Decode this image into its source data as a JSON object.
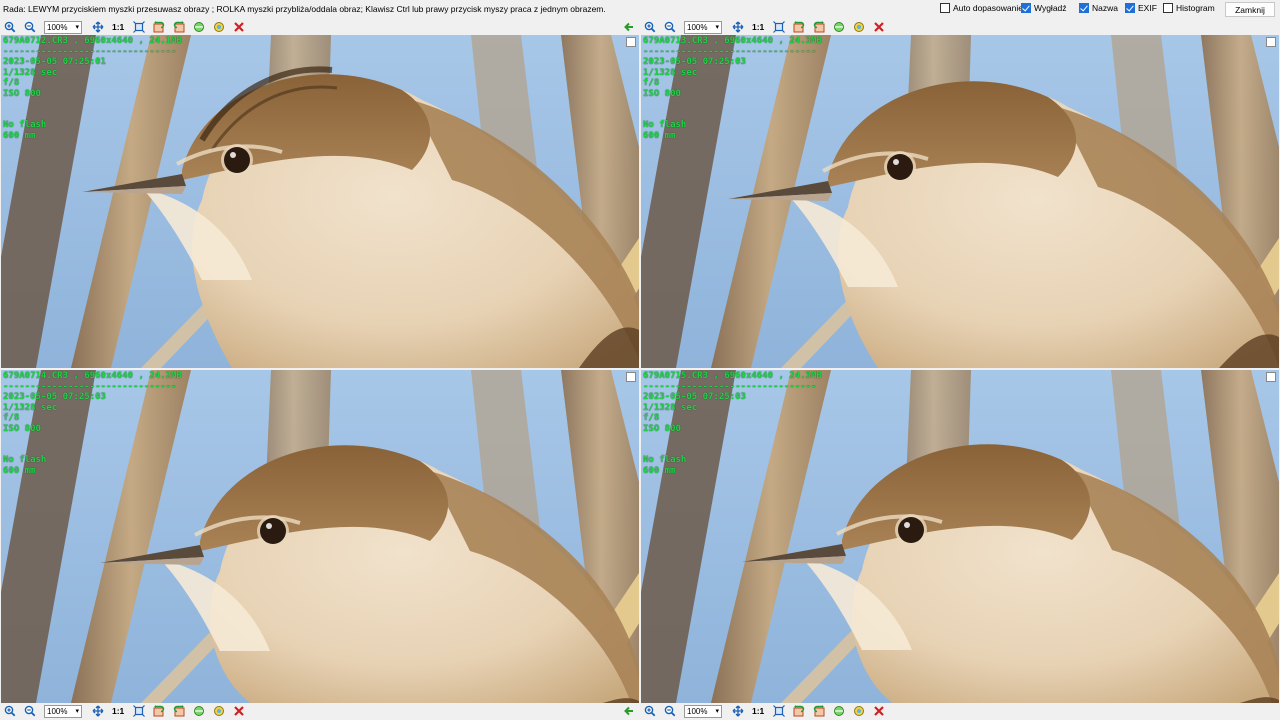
{
  "hint": "Rada: LEWYM przyciskiem myszki przesuwasz obrazy ; ROLKA myszki przybliża/oddala obraz; Klawisz Ctrl lub prawy przycisk myszy praca z jednym obrazem.",
  "options": {
    "auto_fit": {
      "label": "Auto dopasowanie",
      "checked": false
    },
    "smooth": {
      "label": "Wygładź",
      "checked": true
    },
    "name": {
      "label": "Nazwa",
      "checked": true
    },
    "exif": {
      "label": "EXIF",
      "checked": true
    },
    "histogram": {
      "label": "Histogram",
      "checked": false
    }
  },
  "close_label": "Zamknij",
  "toolbar": {
    "zoom_value": "100%",
    "one_to_one": "1:1",
    "icons": [
      "zoom-in-icon",
      "zoom-out-icon",
      "fit-icon",
      "actual-size-icon",
      "rotate-left-icon",
      "rotate-right-icon",
      "flip-icon",
      "color-icon",
      "delete-icon"
    ]
  },
  "panels": [
    {
      "title": "679A0712.CR3 , 6960x4640 , 24.1MB",
      "separator": "--------------------------------",
      "date": "2023-05-05 07:25:01",
      "shutter": "1/1328 sec",
      "aperture": "f/8",
      "iso": "ISO 800",
      "flash": "No flash",
      "focal": "600 mm"
    },
    {
      "title": "679A0713.CR3 , 6960x4640 , 24.3MB",
      "separator": "--------------------------------",
      "date": "2023-05-05 07:25:03",
      "shutter": "1/1328 sec",
      "aperture": "f/8",
      "iso": "ISO 800",
      "flash": "No flash",
      "focal": "600 mm"
    },
    {
      "title": "679A0714.CR3 , 6960x4640 , 24.2MB",
      "separator": "--------------------------------",
      "date": "2023-05-05 07:25:03",
      "shutter": "1/1328 sec",
      "aperture": "f/8",
      "iso": "ISO 800",
      "flash": "No flash",
      "focal": "600 mm"
    },
    {
      "title": "679A0715.CR3 , 6960x4640 , 24.3MB",
      "separator": "--------------------------------",
      "date": "2023-05-05 07:25:03",
      "shutter": "1/1328 sec",
      "aperture": "f/8",
      "iso": "ISO 800",
      "flash": "No flash",
      "focal": "600 mm"
    }
  ],
  "colors": {
    "overlay_text": "#22d14a",
    "sky": "#9fc2e6",
    "reed": "#c9a77a",
    "bird_back": "#a98356",
    "bird_belly": "#f1e2cc"
  }
}
